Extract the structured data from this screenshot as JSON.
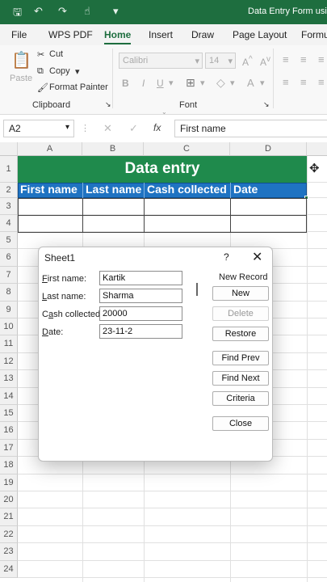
{
  "window": {
    "title": "Data Entry Form using"
  },
  "tabs": [
    "File",
    "WPS PDF",
    "Home",
    "Insert",
    "Draw",
    "Page Layout",
    "Formu"
  ],
  "active_tab": "Home",
  "clipboard": {
    "paste": "Paste",
    "cut": "Cut",
    "copy": "Copy",
    "format_painter": "Format Painter",
    "group": "Clipboard"
  },
  "font": {
    "name": "Calibri",
    "size": "14",
    "group": "Font"
  },
  "formula_bar": {
    "name_box": "A2",
    "fx": "fx",
    "value": "First name"
  },
  "columns": [
    "A",
    "B",
    "C",
    "D"
  ],
  "rows": [
    "1",
    "2",
    "3",
    "4",
    "5",
    "6",
    "7",
    "8",
    "9",
    "10",
    "11",
    "12",
    "13",
    "14",
    "15",
    "16",
    "17",
    "18",
    "19",
    "20",
    "21",
    "22",
    "23",
    "24"
  ],
  "sheet": {
    "title": "Data entry",
    "headers": [
      "First name",
      "Last name",
      "Cash collected",
      "Date"
    ],
    "colors": {
      "title_band": "#1f8a4c",
      "header_band": "#1f73c2"
    }
  },
  "dialog": {
    "title": "Sheet1",
    "help": "?",
    "close": "✕",
    "record_status": "New Record",
    "fields": [
      {
        "label": "First name:",
        "ul": "F",
        "rest": "irst name:",
        "value": "Kartik"
      },
      {
        "label": "Last name:",
        "ul": "L",
        "rest": "ast name:",
        "value": "Sharma"
      },
      {
        "label": "Cash collected:",
        "pre": "C",
        "ul": "a",
        "rest": "sh collected:",
        "value": "20000"
      },
      {
        "label": "Date:",
        "ul": "D",
        "rest": "ate:",
        "value": "23-11-2"
      }
    ],
    "buttons": {
      "new": "New",
      "delete": "Delete",
      "restore": "Restore",
      "find_prev": "Find Prev",
      "find_next": "Find Next",
      "criteria": "Criteria",
      "close": "Close"
    }
  }
}
